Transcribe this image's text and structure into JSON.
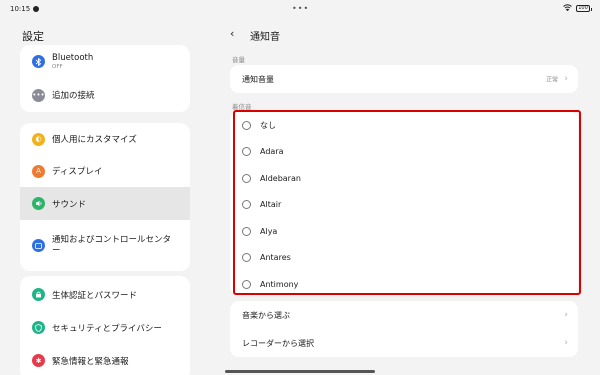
{
  "status_bar": {
    "time": "10:15",
    "center": "•••",
    "battery": "100"
  },
  "sidebar": {
    "title": "設定",
    "group1": [
      {
        "label": "Bluetooth",
        "sub": "OFF",
        "icon": "bluetooth-icon",
        "color": "#2f6fe4"
      },
      {
        "label": "追加の接続",
        "icon": "more-icon",
        "color": "#8c8c98"
      }
    ],
    "group2": [
      {
        "label": "個人用にカスタマイズ",
        "icon": "palette-icon",
        "color": "#f2b21b"
      },
      {
        "label": "ディスプレイ",
        "icon": "display-icon",
        "color": "#f07a2e"
      },
      {
        "label": "サウンド",
        "icon": "sound-icon",
        "color": "#2cb56a",
        "selected": true
      },
      {
        "label": "通知およびコントロールセンター",
        "icon": "notification-icon",
        "color": "#2f6fe4"
      }
    ],
    "group3": [
      {
        "label": "生体認証とパスワード",
        "icon": "lock-icon",
        "color": "#1fb38a"
      },
      {
        "label": "セキュリティとプライバシー",
        "icon": "shield-icon",
        "color": "#1fb38a"
      },
      {
        "label": "緊急情報と緊急通報",
        "icon": "emergency-icon",
        "color": "#e8394a"
      }
    ]
  },
  "main": {
    "back_label": "‹",
    "title": "通知音",
    "volume_section_label": "音量",
    "volume_row": {
      "label": "通知音量",
      "value": "正常"
    },
    "ringtone_section_label": "着信音",
    "ringtones": [
      "なし",
      "Adara",
      "Aldebaran",
      "Altair",
      "Alya",
      "Antares",
      "Antimony"
    ],
    "extra_rows": [
      "音楽から選ぶ",
      "レコーダーから選択"
    ]
  },
  "colors": {
    "highlight": "#d90000"
  }
}
